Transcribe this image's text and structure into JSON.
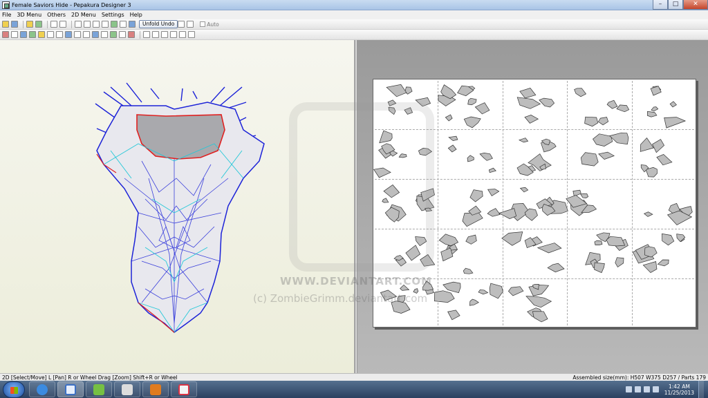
{
  "window": {
    "title": "Female Saviors Hide - Pepakura Designer 3",
    "min_label": "–",
    "max_label": "□",
    "close_label": "✕"
  },
  "menu": [
    "File",
    "3D Menu",
    "Others",
    "2D Menu",
    "Settings",
    "Help"
  ],
  "toolbar": {
    "unfold_undo_label": "Unfold Undo",
    "auto_label": "Auto"
  },
  "status": {
    "left": "2D [Select/Move] L [Pan] R or Wheel Drag [Zoom] Shift+R or Wheel",
    "right": "Assembled size(mm): H507 W375 D257 / Parts 179"
  },
  "watermark": {
    "line1": "WWW.DEVIANTART.COM",
    "line2": "(c) ZombieGrimm.deviantart.com"
  },
  "clock": {
    "time": "1:42 AM",
    "date": "11/25/2013"
  },
  "taskbar": {
    "apps": [
      "internet-explorer",
      "pepakura-designer",
      "notepad-plus",
      "file-explorer",
      "media-app",
      "paint-app"
    ]
  },
  "colors": {
    "mesh_outline": "#1c22d8",
    "mesh_inner": "#24c8d8",
    "cut_line": "#e02020",
    "part_fill": "#bdbdbd"
  },
  "layout_sheet": {
    "columns": 5,
    "rows": 5,
    "empty_cells": 2
  }
}
